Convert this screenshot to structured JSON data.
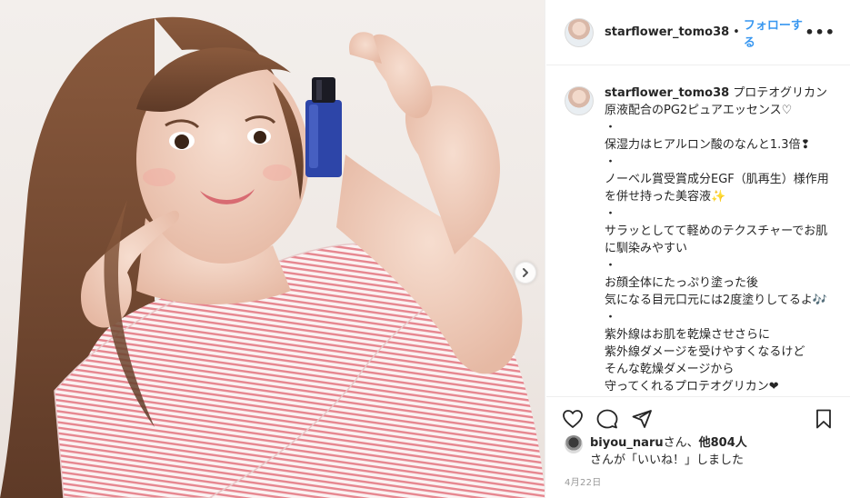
{
  "post": {
    "username": "starflower_tomo38",
    "separator": "•",
    "follow_label": "フォローする",
    "more_label": "•••",
    "caption_text": "プロテオグリカン原液配合のPG2ピュアエッセンス♡\n・\n保湿力はヒアルロン酸のなんと1.3倍❢\n・\nノーベル賞受賞成分EGF（肌再生）様作用を併せ持った美容液✨\n・\nサラッとしてて軽めのテクスチャーでお肌に馴染みやすい\n・\nお顔全体にたっぷり塗った後\n気になる目元口元には2度塗りしてるよ🎶\n・\n紫外線はお肌を乾燥させさらに\n紫外線ダメージを受けやすくなるけど\nそんな乾燥ダメージから\n守ってくれるプロテオグリカン❤"
  },
  "likes": {
    "liker": "biyou_naru",
    "suffix": "さん、",
    "others": "他804人",
    "line2": "さんが「いいね！」しました"
  },
  "date": "4月22日",
  "icons": {
    "like": "heart-icon",
    "comment": "comment-icon",
    "share": "share-icon",
    "save": "bookmark-icon",
    "next": "chevron-right-icon"
  },
  "colors": {
    "accent": "#3897f0",
    "text": "#262626",
    "muted": "#999999",
    "border": "#efefef"
  }
}
